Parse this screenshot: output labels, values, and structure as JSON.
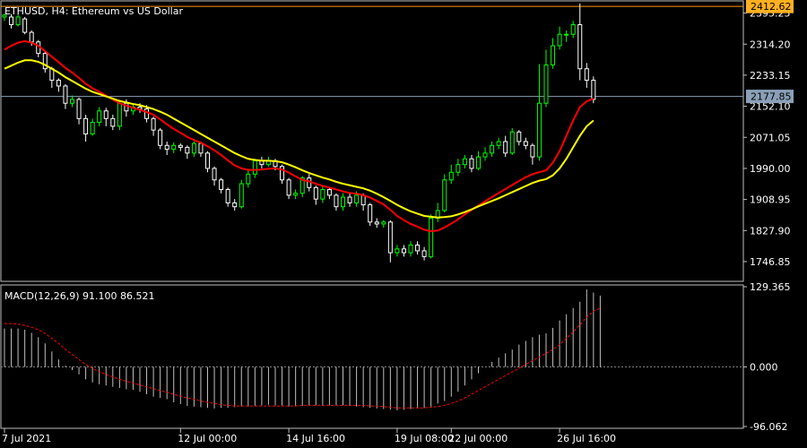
{
  "header": {
    "title": "ETHUSD, H4:  Ethereum vs US Dollar"
  },
  "price_panel": {
    "ylim": [
      1700,
      2420
    ],
    "y_ticks": [
      "2395.25",
      "2314.20",
      "2233.15",
      "2152.10",
      "2071.05",
      "1990.00",
      "1908.95",
      "1827.90",
      "1746.85"
    ],
    "high_line": {
      "value": 2412.62,
      "label": "2412.62"
    },
    "current_line": {
      "value": 2177.85,
      "label": "2177.85"
    }
  },
  "macd_panel": {
    "title": "MACD(12,26,9) 91.100 86.521",
    "ylim": [
      -96.062,
      129.365
    ],
    "y_ticks": [
      "129.365",
      "0.000",
      "-96.062"
    ]
  },
  "x_axis": {
    "labels": [
      "7 Jul 2021",
      "12 Jul 00:00",
      "14 Jul 16:00",
      "19 Jul 08:00",
      "22 Jul 00:00",
      "26 Jul 16:00"
    ],
    "label_bars": [
      0,
      26,
      42,
      58,
      66,
      82
    ]
  },
  "colors": {
    "background": "#000000",
    "up_candle": "#00ff00",
    "down_candle": "#ffffff",
    "ma_fast": "#ff0000",
    "ma_slow": "#ffff00",
    "macd_hist": "#c0c0c0",
    "macd_signal": "#ff0000",
    "high_line": "#ff9900",
    "high_tag_bg": "#ffb020",
    "current_line": "#8aa0b8",
    "current_tag_bg": "#8aa0b8",
    "grid_border": "#c0c0c0"
  },
  "chart_data": [
    {
      "type": "candlestick",
      "title": "ETHUSD, H4:  Ethereum vs US Dollar",
      "candles": [
        [
          2385,
          2390,
          2375,
          2393
        ],
        [
          2385,
          2365,
          2355,
          2392
        ],
        [
          2365,
          2385,
          2360,
          2392
        ],
        [
          2380,
          2345,
          2340,
          2385
        ],
        [
          2345,
          2320,
          2310,
          2350
        ],
        [
          2320,
          2290,
          2280,
          2325
        ],
        [
          2290,
          2250,
          2240,
          2295
        ],
        [
          2250,
          2220,
          2200,
          2255
        ],
        [
          2220,
          2205,
          2190,
          2225
        ],
        [
          2205,
          2160,
          2145,
          2210
        ],
        [
          2160,
          2170,
          2150,
          2180
        ],
        [
          2170,
          2120,
          2105,
          2175
        ],
        [
          2120,
          2080,
          2060,
          2130
        ],
        [
          2080,
          2110,
          2075,
          2120
        ],
        [
          2110,
          2140,
          2100,
          2150
        ],
        [
          2140,
          2120,
          2100,
          2148
        ],
        [
          2120,
          2100,
          2090,
          2130
        ],
        [
          2100,
          2160,
          2090,
          2168
        ],
        [
          2160,
          2140,
          2125,
          2170
        ],
        [
          2140,
          2150,
          2130,
          2158
        ],
        [
          2150,
          2145,
          2135,
          2160
        ],
        [
          2145,
          2120,
          2110,
          2155
        ],
        [
          2120,
          2090,
          2075,
          2125
        ],
        [
          2090,
          2050,
          2040,
          2095
        ],
        [
          2050,
          2040,
          2025,
          2060
        ],
        [
          2040,
          2050,
          2030,
          2058
        ],
        [
          2050,
          2045,
          2035,
          2055
        ],
        [
          2045,
          2030,
          2015,
          2050
        ],
        [
          2030,
          2055,
          2020,
          2060
        ],
        [
          2055,
          2030,
          2020,
          2060
        ],
        [
          2030,
          1990,
          1980,
          2035
        ],
        [
          1990,
          1960,
          1945,
          1995
        ],
        [
          1960,
          1935,
          1925,
          1965
        ],
        [
          1935,
          1900,
          1890,
          1940
        ],
        [
          1900,
          1890,
          1880,
          1910
        ],
        [
          1890,
          1950,
          1885,
          1960
        ],
        [
          1950,
          1975,
          1940,
          1985
        ],
        [
          1975,
          2010,
          1965,
          2015
        ],
        [
          2010,
          2000,
          1990,
          2020
        ],
        [
          2000,
          2010,
          1995,
          2020
        ],
        [
          2010,
          1995,
          1985,
          2015
        ],
        [
          1995,
          1960,
          1950,
          2000
        ],
        [
          1960,
          1920,
          1910,
          1965
        ],
        [
          1920,
          1925,
          1910,
          1935
        ],
        [
          1925,
          1965,
          1915,
          1970
        ],
        [
          1965,
          1940,
          1930,
          1975
        ],
        [
          1940,
          1910,
          1895,
          1945
        ],
        [
          1910,
          1935,
          1900,
          1945
        ],
        [
          1935,
          1920,
          1910,
          1940
        ],
        [
          1920,
          1890,
          1880,
          1925
        ],
        [
          1890,
          1915,
          1880,
          1925
        ],
        [
          1915,
          1900,
          1890,
          1925
        ],
        [
          1900,
          1920,
          1890,
          1930
        ],
        [
          1920,
          1895,
          1880,
          1925
        ],
        [
          1895,
          1850,
          1840,
          1900
        ],
        [
          1850,
          1845,
          1835,
          1860
        ],
        [
          1845,
          1850,
          1835,
          1855
        ],
        [
          1850,
          1770,
          1745,
          1855
        ],
        [
          1770,
          1780,
          1760,
          1790
        ],
        [
          1780,
          1770,
          1760,
          1790
        ],
        [
          1770,
          1790,
          1760,
          1800
        ],
        [
          1790,
          1775,
          1765,
          1800
        ],
        [
          1775,
          1760,
          1750,
          1785
        ],
        [
          1760,
          1860,
          1755,
          1870
        ],
        [
          1860,
          1880,
          1850,
          1900
        ],
        [
          1880,
          1960,
          1875,
          1975
        ],
        [
          1960,
          1980,
          1950,
          2000
        ],
        [
          1980,
          2000,
          1970,
          2015
        ],
        [
          2000,
          2015,
          1990,
          2025
        ],
        [
          2015,
          1990,
          1980,
          2025
        ],
        [
          1990,
          2020,
          1985,
          2035
        ],
        [
          2020,
          2030,
          2010,
          2045
        ],
        [
          2030,
          2050,
          2020,
          2060
        ],
        [
          2050,
          2060,
          2040,
          2070
        ],
        [
          2060,
          2030,
          2020,
          2075
        ],
        [
          2030,
          2085,
          2025,
          2095
        ],
        [
          2085,
          2060,
          2050,
          2090
        ],
        [
          2060,
          2050,
          2040,
          2070
        ],
        [
          2050,
          2020,
          2000,
          2055
        ],
        [
          2020,
          2160,
          2010,
          2262
        ],
        [
          2160,
          2260,
          2150,
          2300
        ],
        [
          2260,
          2310,
          2250,
          2330
        ],
        [
          2310,
          2340,
          2300,
          2360
        ],
        [
          2340,
          2340,
          2320,
          2350
        ],
        [
          2340,
          2365,
          2330,
          2375
        ],
        [
          2365,
          2250,
          2220,
          2420
        ],
        [
          2250,
          2220,
          2200,
          2265
        ],
        [
          2220,
          2170,
          2160,
          2230
        ]
      ],
      "series": [
        {
          "name": "MA fast",
          "color": "#ff0000",
          "values": [
            2300,
            2310,
            2318,
            2322,
            2318,
            2310,
            2296,
            2281,
            2267,
            2252,
            2240,
            2226,
            2211,
            2199,
            2190,
            2180,
            2170,
            2160,
            2154,
            2148,
            2143,
            2137,
            2130,
            2118,
            2105,
            2093,
            2083,
            2072,
            2064,
            2057,
            2048,
            2037,
            2025,
            2011,
            1998,
            1990,
            1986,
            1986,
            1987,
            1989,
            1990,
            1987,
            1979,
            1969,
            1960,
            1956,
            1950,
            1944,
            1940,
            1935,
            1930,
            1926,
            1924,
            1920,
            1914,
            1905,
            1896,
            1882,
            1866,
            1855,
            1845,
            1838,
            1830,
            1826,
            1828,
            1836,
            1846,
            1857,
            1870,
            1882,
            1893,
            1904,
            1915,
            1926,
            1936,
            1947,
            1957,
            1967,
            1975,
            1980,
            1985,
            2005,
            2035,
            2075,
            2115,
            2150,
            2165,
            2172
          ]
        },
        {
          "name": "MA slow",
          "color": "#ffff00",
          "values": [
            2250,
            2258,
            2266,
            2272,
            2272,
            2268,
            2260,
            2250,
            2240,
            2228,
            2218,
            2208,
            2198,
            2190,
            2184,
            2178,
            2172,
            2166,
            2162,
            2158,
            2155,
            2150,
            2145,
            2138,
            2130,
            2120,
            2110,
            2100,
            2090,
            2080,
            2070,
            2060,
            2050,
            2040,
            2030,
            2022,
            2015,
            2012,
            2010,
            2010,
            2009,
            2006,
            2000,
            1993,
            1985,
            1978,
            1972,
            1966,
            1961,
            1955,
            1950,
            1946,
            1942,
            1938,
            1932,
            1924,
            1915,
            1905,
            1895,
            1886,
            1878,
            1872,
            1866,
            1864,
            1862,
            1863,
            1865,
            1870,
            1876,
            1883,
            1891,
            1898,
            1905,
            1912,
            1920,
            1928,
            1936,
            1944,
            1952,
            1958,
            1962,
            1972,
            1990,
            2015,
            2045,
            2075,
            2100,
            2115
          ]
        }
      ],
      "ylim": [
        1700,
        2420
      ]
    },
    {
      "type": "bar",
      "title": "MACD(12,26,9) 91.100 86.521",
      "series": [
        {
          "name": "MACD",
          "color": "#c0c0c0",
          "values": [
            62,
            62,
            62,
            60,
            55,
            48,
            38,
            25,
            12,
            2,
            -5,
            -12,
            -20,
            -25,
            -28,
            -30,
            -32,
            -34,
            -36,
            -37,
            -40,
            -44,
            -48,
            -50,
            -52,
            -57,
            -60,
            -63,
            -64,
            -65,
            -66,
            -67,
            -66,
            -66,
            -65,
            -64,
            -64,
            -63,
            -62,
            -61,
            -62,
            -62,
            -64,
            -63,
            -63,
            -62,
            -62,
            -63,
            -62,
            -62,
            -62,
            -63,
            -64,
            -65,
            -66,
            -67,
            -68,
            -69,
            -70,
            -69,
            -68,
            -67,
            -66,
            -64,
            -59,
            -55,
            -48,
            -40,
            -30,
            -20,
            -10,
            0,
            8,
            15,
            22,
            28,
            36,
            42,
            48,
            52,
            54,
            63,
            75,
            85,
            95,
            105,
            125,
            120,
            115
          ]
        },
        {
          "name": "Signal",
          "color": "#ff0000",
          "values": [
            70,
            70,
            69,
            67,
            64,
            60,
            54,
            46,
            38,
            28,
            20,
            12,
            4,
            -2,
            -8,
            -12,
            -16,
            -20,
            -23,
            -26,
            -29,
            -32,
            -35,
            -38,
            -41,
            -44,
            -47,
            -50,
            -52,
            -55,
            -57,
            -59,
            -61,
            -62,
            -63,
            -63,
            -63,
            -63,
            -63,
            -63,
            -63,
            -63,
            -63,
            -63,
            -62,
            -62,
            -62,
            -62,
            -62,
            -62,
            -62,
            -62,
            -62,
            -62,
            -63,
            -63,
            -64,
            -65,
            -66,
            -66,
            -66,
            -66,
            -66,
            -65,
            -64,
            -62,
            -59,
            -55,
            -50,
            -44,
            -38,
            -32,
            -26,
            -20,
            -14,
            -8,
            -2,
            4,
            10,
            16,
            22,
            28,
            36,
            46,
            56,
            68,
            80,
            90,
            95
          ]
        }
      ],
      "ylim": [
        -96.062,
        129.365
      ]
    }
  ]
}
